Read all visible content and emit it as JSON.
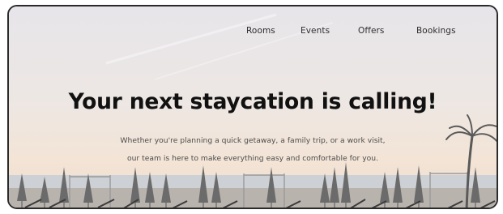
{
  "nav": {
    "items": [
      "Rooms",
      "Events",
      "Offers",
      "Bookings"
    ]
  },
  "hero": {
    "title": "Your next staycation is calling!",
    "subtitle_line1": "Whether you're planning a quick getaway, a family trip, or a work visit,",
    "subtitle_line2": "our team is here to make everything easy and comfortable for you."
  },
  "colors": {
    "sky_top": "#e9e6e9",
    "sky_mid": "#efe7e2",
    "horizon": "#f2e3d6",
    "sea": "#c9cdd3",
    "title_text": "#111111",
    "frame_border": "#2b2b2b"
  }
}
